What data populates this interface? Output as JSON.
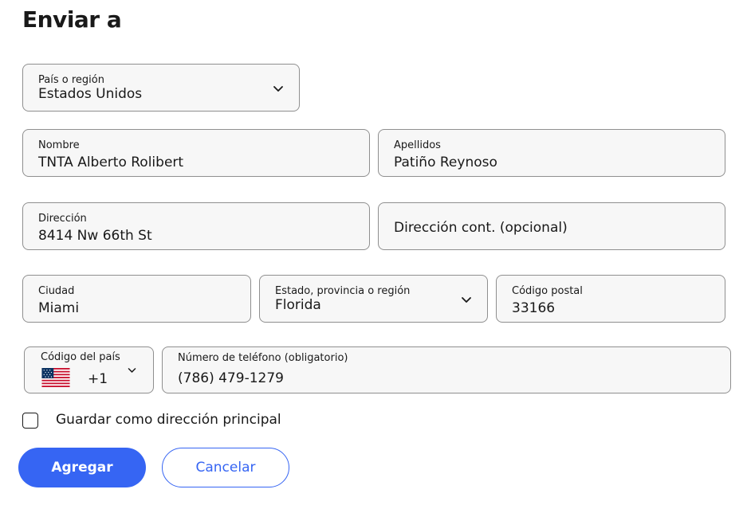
{
  "page": {
    "title": "Enviar a"
  },
  "country": {
    "label": "País o región",
    "value": "Estados Unidos"
  },
  "first_name": {
    "label": "Nombre",
    "value": "TNTA Alberto Rolibert"
  },
  "last_name": {
    "label": "Apellidos",
    "value": "Patiño Reynoso"
  },
  "address": {
    "label": "Dirección",
    "value": "8414 Nw 66th St"
  },
  "address2": {
    "placeholder": "Dirección cont. (opcional)"
  },
  "city": {
    "label": "Ciudad",
    "value": "Miami"
  },
  "state": {
    "label": "Estado, provincia o región",
    "value": "Florida"
  },
  "postal": {
    "label": "Código postal",
    "value": "33166"
  },
  "country_code": {
    "label": "Código del país",
    "value": "+1",
    "flag": "us-flag-icon"
  },
  "phone": {
    "label": "Número de teléfono (obligatorio)",
    "value": "(786) 479-1279"
  },
  "save_default": {
    "label": "Guardar como dirección principal",
    "checked": false
  },
  "actions": {
    "add_label": "Agregar",
    "cancel_label": "Cancelar"
  },
  "colors": {
    "primary": "#3665f3",
    "field_bg": "#f7f7f7",
    "border": "#8f8f8f"
  }
}
